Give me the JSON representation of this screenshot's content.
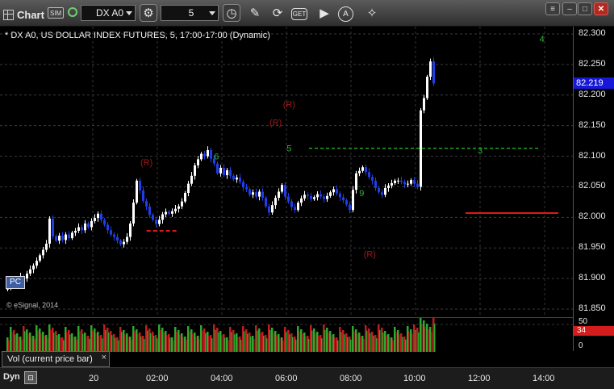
{
  "toolbar": {
    "app_title": "Chart",
    "sim_badge": "SIM",
    "symbol_value": "DX A0",
    "interval_value": "5",
    "icons": [
      "gear-icon",
      "refresh-clock-icon",
      "pencil-icon",
      "cycle-icon",
      "get-icon",
      "play-icon",
      "alert-icon",
      "ruler-icon"
    ],
    "get_label": "GET",
    "alert_label": "A"
  },
  "chart": {
    "title": "* DX A0, US DOLLAR INDEX FUTURES, 5, 17:00-17:00 (Dynamic)",
    "copyright": "© eSignal, 2014",
    "pc_label": "PC",
    "last_price": "82.219",
    "price_levels": [
      "82.300",
      "82.250",
      "82.200",
      "82.150",
      "82.100",
      "82.050",
      "82.000",
      "81.950",
      "81.900",
      "81.850"
    ],
    "colors": {
      "up": "#ffffff",
      "down": "#1f3ee8",
      "green_level": "#1fa21f",
      "red_level": "#e01818",
      "ann": "#2fb52f",
      "r_mark": "#a01818"
    }
  },
  "chart_data": {
    "type": "candlestick",
    "interval": "5",
    "ylim": [
      81.85,
      82.3
    ],
    "x_ticks": [
      "20",
      "02:00",
      "04:00",
      "06:00",
      "08:00",
      "10:00",
      "12:00",
      "14:00"
    ],
    "closes": [
      81.886,
      81.893,
      81.889,
      81.897,
      81.904,
      81.9,
      81.908,
      81.915,
      81.921,
      81.929,
      81.938,
      81.947,
      81.957,
      81.998,
      81.969,
      81.962,
      81.97,
      81.963,
      81.972,
      81.966,
      81.975,
      81.978,
      81.984,
      81.979,
      81.99,
      81.984,
      81.994,
      81.999,
      82.006,
      81.996,
      81.988,
      81.979,
      81.972,
      81.968,
      81.962,
      81.956,
      81.96,
      81.968,
      81.99,
      82.024,
      82.06,
      82.044,
      82.027,
      82.018,
      82.004,
      81.996,
      81.989,
      81.996,
      82.005,
      82.009,
      82.006,
      82.01,
      82.014,
      82.018,
      82.026,
      82.04,
      82.055,
      82.068,
      82.085,
      82.095,
      82.104,
      82.1,
      82.11,
      82.096,
      82.088,
      82.072,
      82.081,
      82.069,
      82.077,
      82.068,
      82.062,
      82.065,
      82.058,
      82.049,
      82.046,
      82.037,
      82.041,
      82.034,
      82.042,
      82.032,
      82.018,
      82.008,
      82.02,
      82.032,
      82.042,
      82.053,
      82.034,
      82.026,
      82.017,
      82.012,
      82.024,
      82.031,
      82.037,
      82.035,
      82.03,
      82.033,
      82.038,
      82.034,
      82.03,
      82.035,
      82.041,
      82.046,
      82.039,
      82.033,
      82.028,
      82.021,
      82.012,
      82.045,
      82.072,
      82.076,
      82.082,
      82.074,
      82.066,
      82.06,
      82.048,
      82.041,
      82.037,
      82.048,
      82.052,
      82.056,
      82.06,
      82.06,
      82.058,
      82.054,
      82.055,
      82.061,
      82.055,
      82.05,
      82.175,
      82.195,
      82.23,
      82.255,
      82.219
    ],
    "green_level": 82.113,
    "red_levels": [
      {
        "from": "01:55",
        "value": 81.978
      },
      {
        "from": "11:30",
        "value": 82.007
      }
    ],
    "annotations": [
      {
        "text": "(R)",
        "time": "01:40",
        "price": 82.085,
        "color": "r"
      },
      {
        "text": "(R)",
        "time": "05:40",
        "price": 82.15,
        "color": "r"
      },
      {
        "text": "(R)",
        "time": "06:05",
        "price": 82.18,
        "color": "r"
      },
      {
        "text": "(R)",
        "time": "08:35",
        "price": 81.935,
        "color": "r"
      },
      {
        "text": "6",
        "time": "03:50",
        "price": 82.095,
        "color": "g"
      },
      {
        "text": "4",
        "time": "13:55",
        "price": 82.287,
        "color": "g"
      },
      {
        "text": "5",
        "time": "06:05",
        "price": 82.108,
        "color": "g"
      },
      {
        "text": "9",
        "time": "08:20",
        "price": 82.035,
        "color": "g"
      },
      {
        "text": "3",
        "time": "12:00",
        "price": 82.105,
        "color": "g"
      }
    ],
    "volume": {
      "axis_labels": [
        "50",
        "34",
        "0"
      ],
      "last_volume": "34",
      "title": "Vol (current price bar)"
    }
  },
  "footer": {
    "mode_label": "Dyn"
  }
}
